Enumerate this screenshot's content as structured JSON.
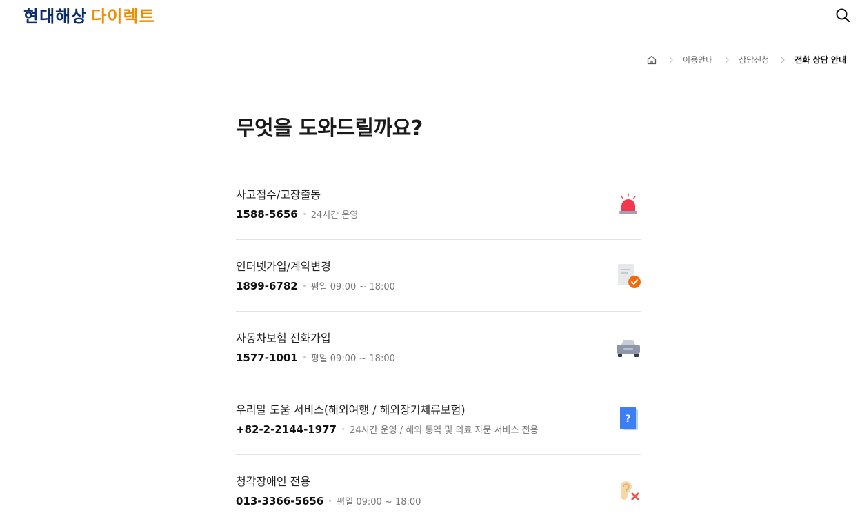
{
  "header": {
    "logo_primary": "현대해상",
    "logo_secondary": "다이렉트",
    "logo_primary_color": "#0b2d6b",
    "logo_secondary_color": "#f08c00",
    "search_icon": "search-icon"
  },
  "breadcrumb": {
    "home_icon": "home-icon",
    "items": [
      "이용안내",
      "상담신청",
      "전화 상담 안내"
    ]
  },
  "page": {
    "title": "무엇을 도와드릴까요?"
  },
  "services": [
    {
      "name": "사고접수/고장출동",
      "phone": "1588-5656",
      "hours": "24시간 운영",
      "icon": "siren-icon"
    },
    {
      "name": "인터넷가입/계약변경",
      "phone": "1899-6782",
      "hours": "평일 09:00 ~ 18:00",
      "icon": "document-check-icon"
    },
    {
      "name": "자동차보험 전화가입",
      "phone": "1577-1001",
      "hours": "평일 09:00 ~ 18:00",
      "icon": "car-icon"
    },
    {
      "name": "우리말 도움 서비스(해외여행 / 해외장기체류보험)",
      "phone": "+82-2-2144-1977",
      "hours": "24시간 운영 / 해외 통역 및 의료 자문 서비스 전용",
      "icon": "question-book-icon"
    },
    {
      "name": "청각장애인 전용",
      "phone": "013-3366-5656",
      "hours": "평일 09:00 ~ 18:00",
      "icon": "hearing-impaired-icon"
    }
  ]
}
